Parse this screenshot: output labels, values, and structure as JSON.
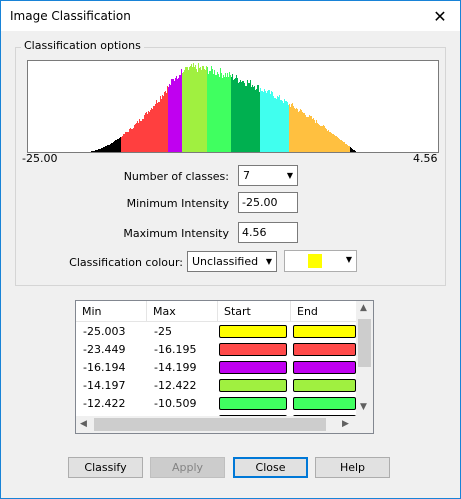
{
  "window": {
    "title": "Image Classification"
  },
  "options": {
    "group_label": "Classification options",
    "histogram": {
      "min_label": "-25.00",
      "max_label": "4.56",
      "class_colors": [
        "#ff3f3f",
        "#c000f0",
        "#a0f040",
        "#40ff60",
        "#00b050",
        "#40ffee",
        "#ffc040"
      ]
    },
    "num_classes_label": "Number of classes:",
    "num_classes_value": "7",
    "min_intensity_label": "Minimum Intensity",
    "min_intensity_value": "-25.00",
    "max_intensity_label": "Maximum Intensity",
    "max_intensity_value": "4.56",
    "colour_label": "Classification colour:",
    "colour_select_value": "Unclassified",
    "colour_swatch": "#ffff00"
  },
  "table": {
    "headers": [
      "Min",
      "Max",
      "Start",
      "End"
    ],
    "rows": [
      {
        "min": "-25.003",
        "max": "-25",
        "start": "#ffff00",
        "end": "#ffff00"
      },
      {
        "min": "-23.449",
        "max": "-16.195",
        "start": "#ff4a4a",
        "end": "#ff4a4a"
      },
      {
        "min": "-16.194",
        "max": "-14.199",
        "start": "#c000f0",
        "end": "#c000f0"
      },
      {
        "min": "-14.197",
        "max": "-12.422",
        "start": "#a0f040",
        "end": "#a0f040"
      },
      {
        "min": "-12.422",
        "max": "-10.509",
        "start": "#40ff60",
        "end": "#40ff60"
      },
      {
        "min": "",
        "max": "",
        "start": "#00b050",
        "end": "#00b050"
      }
    ]
  },
  "buttons": {
    "classify": "Classify",
    "apply": "Apply",
    "close": "Close",
    "help": "Help"
  }
}
